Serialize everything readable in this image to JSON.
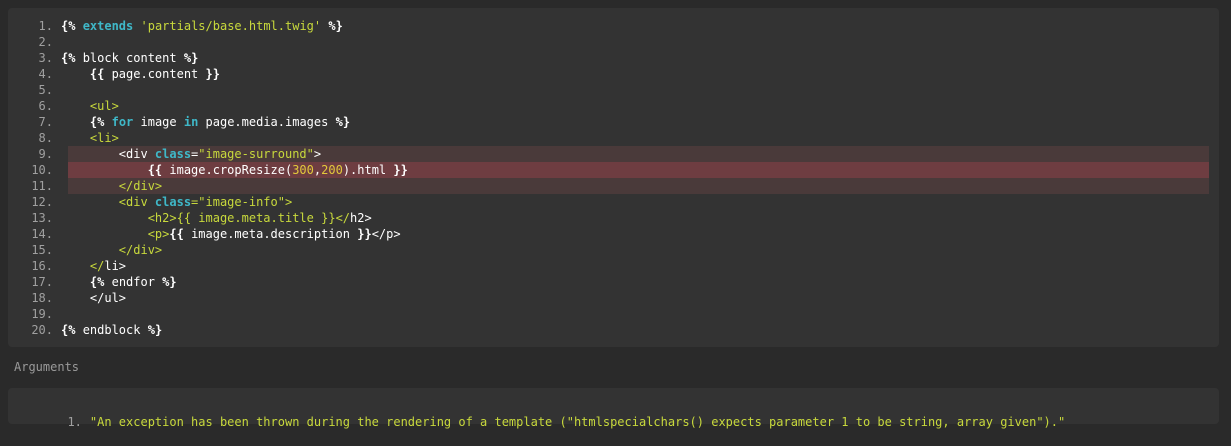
{
  "code_lines": [
    {
      "n": "1.",
      "segs": [
        [
          "tag",
          "{% "
        ],
        [
          "kw",
          "extends"
        ],
        [
          "txt",
          " "
        ],
        [
          "str",
          "'partials/base.html.twig'"
        ],
        [
          "tag",
          " %}"
        ]
      ]
    },
    {
      "n": "2.",
      "segs": []
    },
    {
      "n": "3.",
      "segs": [
        [
          "tag",
          "{% "
        ],
        [
          "txt",
          "block content "
        ],
        [
          "tag",
          "%}"
        ]
      ]
    },
    {
      "n": "4.",
      "segs": [
        [
          "txt",
          "    "
        ],
        [
          "tag",
          "{{"
        ],
        [
          "txt",
          " page.content "
        ],
        [
          "tag",
          "}}"
        ]
      ]
    },
    {
      "n": "5.",
      "segs": []
    },
    {
      "n": "6.",
      "segs": [
        [
          "txt",
          "    "
        ],
        [
          "html-tag",
          "<ul>"
        ]
      ]
    },
    {
      "n": "7.",
      "segs": [
        [
          "txt",
          "    "
        ],
        [
          "tag",
          "{% "
        ],
        [
          "kw",
          "for"
        ],
        [
          "txt",
          " image "
        ],
        [
          "kw",
          "in"
        ],
        [
          "txt",
          " page.media.images "
        ],
        [
          "tag",
          "%}"
        ]
      ]
    },
    {
      "n": "8.",
      "segs": [
        [
          "txt",
          "    "
        ],
        [
          "html-tag",
          "<li>"
        ]
      ]
    },
    {
      "n": "9.",
      "hl": "light",
      "segs": [
        [
          "txt",
          "        <div "
        ],
        [
          "kw",
          "class"
        ],
        [
          "txt",
          "="
        ],
        [
          "str",
          "\"image-surround\""
        ],
        [
          "txt",
          ">"
        ]
      ]
    },
    {
      "n": "10.",
      "hl": "strong",
      "segs": [
        [
          "txt",
          "            "
        ],
        [
          "tag",
          "{{"
        ],
        [
          "txt",
          " image.cropResize("
        ],
        [
          "num",
          "300"
        ],
        [
          "txt",
          ","
        ],
        [
          "num",
          "200"
        ],
        [
          "txt",
          ").html "
        ],
        [
          "tag",
          "}}"
        ]
      ]
    },
    {
      "n": "11.",
      "hl": "light",
      "segs": [
        [
          "txt",
          "        "
        ],
        [
          "html-tag",
          "</div>"
        ]
      ]
    },
    {
      "n": "12.",
      "segs": [
        [
          "txt",
          "        "
        ],
        [
          "html-tag",
          "<div "
        ],
        [
          "kw",
          "class"
        ],
        [
          "html-tag",
          "="
        ],
        [
          "str",
          "\"image-info\""
        ],
        [
          "html-tag",
          ">"
        ]
      ]
    },
    {
      "n": "13.",
      "segs": [
        [
          "txt",
          "            "
        ],
        [
          "html-tag",
          "<h2>"
        ],
        [
          "str",
          "{{ image.meta.title }}"
        ],
        [
          "html-tag",
          "</"
        ],
        [
          "txt",
          "h2>"
        ]
      ]
    },
    {
      "n": "14.",
      "segs": [
        [
          "txt",
          "            "
        ],
        [
          "html-tag",
          "<p>"
        ],
        [
          "tag",
          "{{"
        ],
        [
          "txt",
          " image.meta.description "
        ],
        [
          "tag",
          "}}"
        ],
        [
          "txt",
          "</p>"
        ]
      ]
    },
    {
      "n": "15.",
      "segs": [
        [
          "txt",
          "        "
        ],
        [
          "html-tag",
          "</div>"
        ]
      ]
    },
    {
      "n": "16.",
      "segs": [
        [
          "txt",
          "    "
        ],
        [
          "html-tag",
          "</"
        ],
        [
          "txt",
          "li>"
        ]
      ]
    },
    {
      "n": "17.",
      "segs": [
        [
          "txt",
          "    "
        ],
        [
          "tag",
          "{% "
        ],
        [
          "txt",
          "endfor "
        ],
        [
          "tag",
          "%}"
        ]
      ]
    },
    {
      "n": "18.",
      "segs": [
        [
          "txt",
          "    </ul>"
        ]
      ]
    },
    {
      "n": "19.",
      "segs": []
    },
    {
      "n": "20.",
      "segs": [
        [
          "tag",
          "{% "
        ],
        [
          "txt",
          "endblock "
        ],
        [
          "tag",
          "%}"
        ]
      ]
    }
  ],
  "arguments": {
    "label": "Arguments",
    "items": [
      {
        "n": "1.",
        "text": "\"An exception has been thrown during the rendering of a template (\"htmlspecialchars() expects parameter 1 to be string, array given\").\""
      }
    ]
  },
  "colors": {
    "background": "#2a2a2a",
    "panel": "#333333",
    "keyword": "#3fb8c8",
    "string": "#c8d93c",
    "number": "#e3c93b",
    "highlight_light": "#4a3a3a",
    "highlight_strong": "#6e3d41"
  }
}
